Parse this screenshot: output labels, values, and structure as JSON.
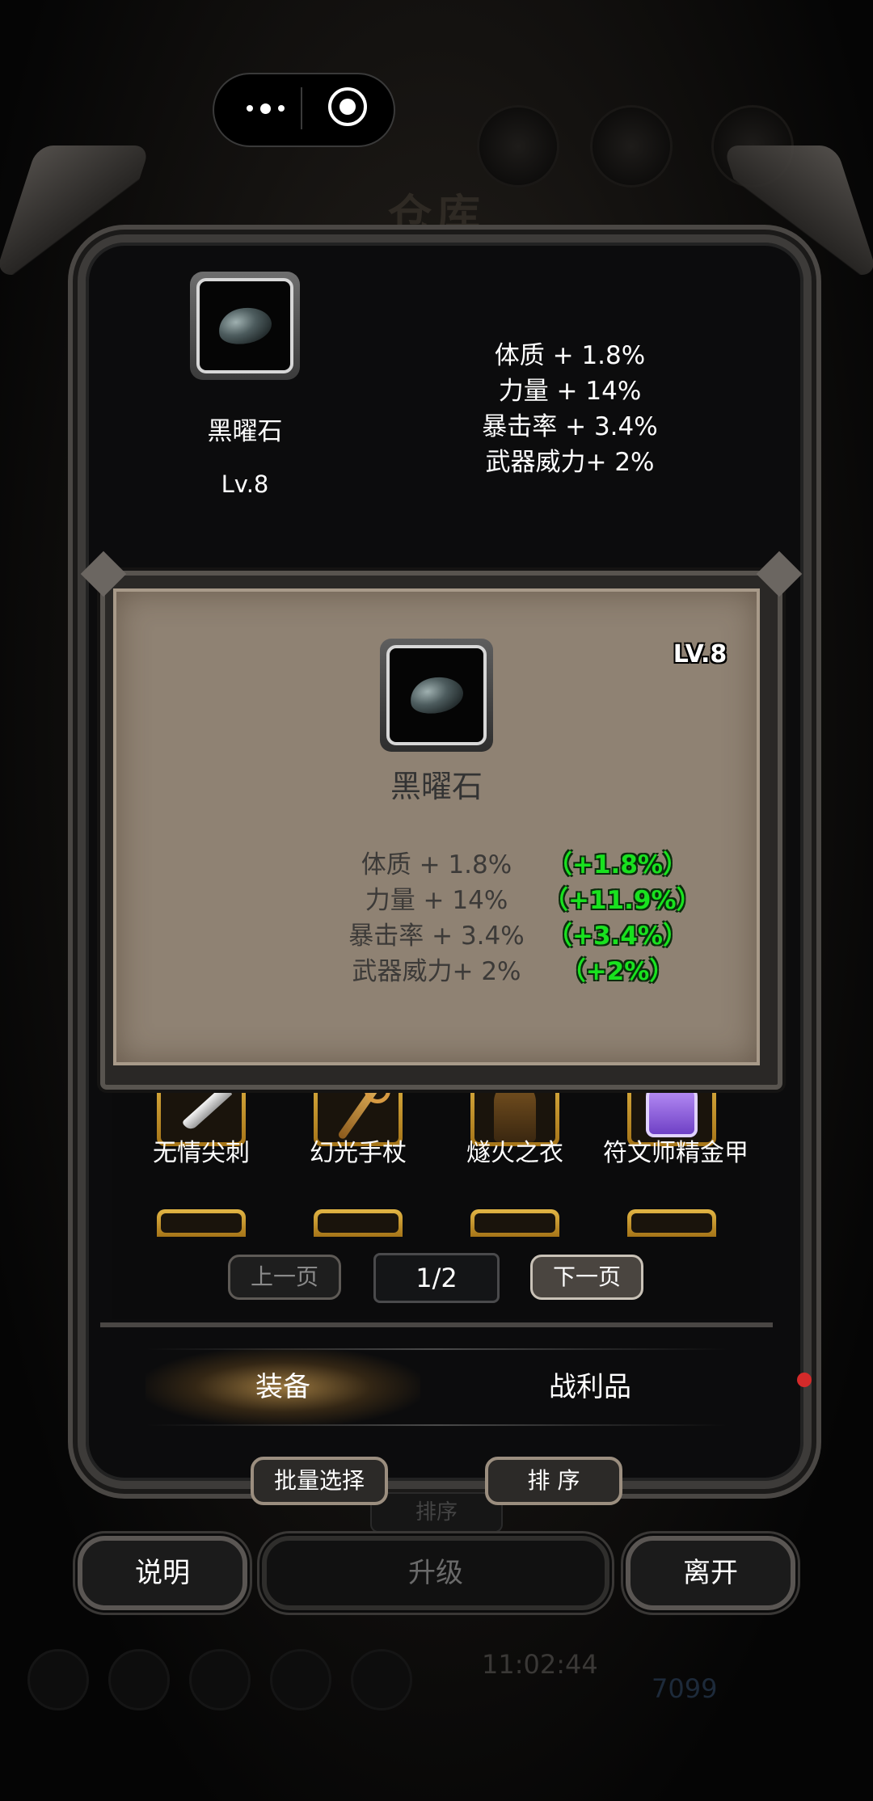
{
  "background": {
    "title": "仓库",
    "time": "11:02:44",
    "gem_count": "7099"
  },
  "capsule": {
    "more_icon": "more-dots-icon",
    "close_icon": "target-close-icon"
  },
  "top_panel": {
    "item_name": "黑曜石",
    "item_level": "Lv.8",
    "stats": [
      "体质 + 1.8%",
      "力量 + 14%",
      "暴击率 + 3.4%",
      "武器威力+ 2%"
    ]
  },
  "popup": {
    "level": "LV.8",
    "item_name": "黑曜石",
    "stats": [
      "体质 + 1.8%",
      "力量 + 14%",
      "暴击率 + 3.4%",
      "武器威力+ 2%"
    ],
    "bonus": [
      "（+1.8%）",
      "（+11.9%）",
      "（+3.4%）",
      "（+2%）"
    ]
  },
  "grid": {
    "items": [
      {
        "name": "无情尖刺",
        "icon": "dagger-icon"
      },
      {
        "name": "幻光手杖",
        "icon": "staff-icon"
      },
      {
        "name": "燧火之衣",
        "icon": "robe-icon"
      },
      {
        "name": "符文师精金甲",
        "icon": "armor-icon"
      }
    ]
  },
  "pagination": {
    "prev": "上一页",
    "indicator": "1/2",
    "next": "下一页"
  },
  "tabs": {
    "equipment": "装备",
    "loot": "战利品"
  },
  "actions": {
    "batch_select": "批量选择",
    "sort": "排 序",
    "sort_hidden": "排序"
  },
  "bottom": {
    "help": "说明",
    "upgrade": "升级",
    "leave": "离开"
  },
  "colors": {
    "bonus_green": "#19e21f",
    "parchment": "#8f8273",
    "gold_border": "#e3b645"
  }
}
